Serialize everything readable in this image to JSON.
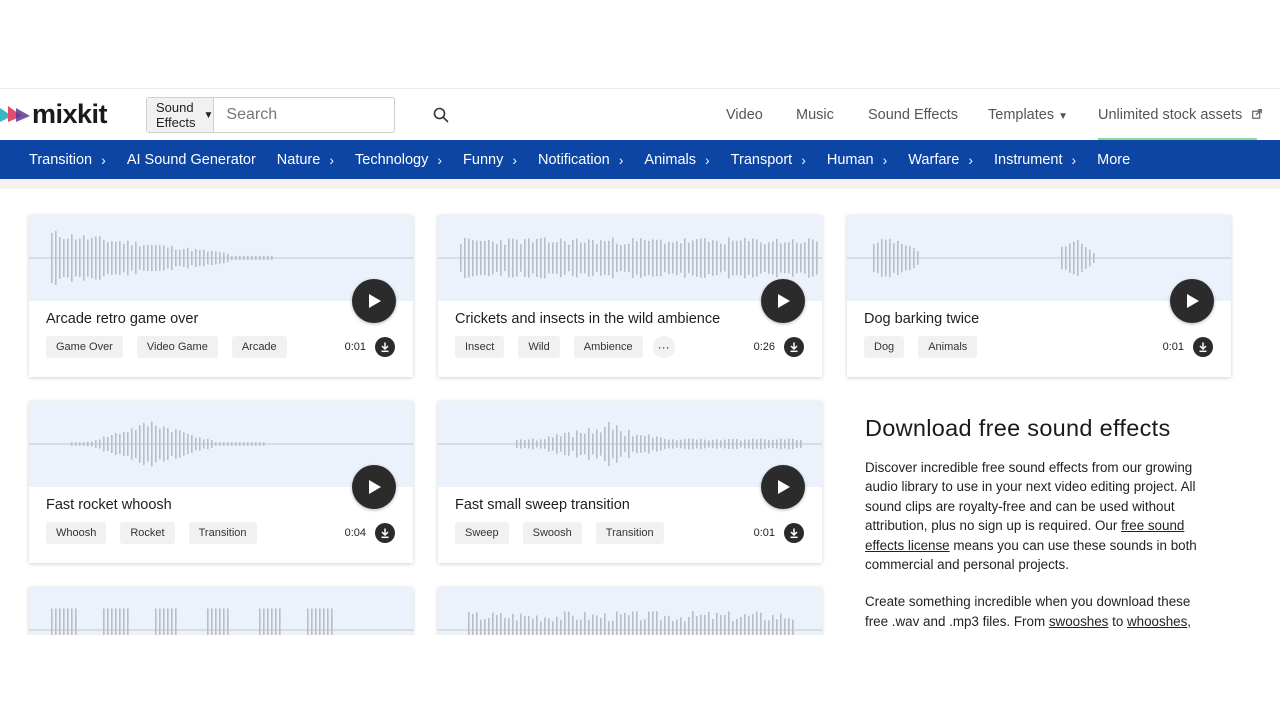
{
  "header": {
    "logo_text": "mixkit",
    "search": {
      "category": "Sound Effects",
      "placeholder": "Search"
    },
    "nav": {
      "video": "Video",
      "music": "Music",
      "sound_effects": "Sound Effects",
      "templates": "Templates",
      "unlimited": "Unlimited stock assets"
    }
  },
  "categories": [
    "Transition",
    "AI Sound Generator",
    "Nature",
    "Technology",
    "Funny",
    "Notification",
    "Animals",
    "Transport",
    "Human",
    "Warfare",
    "Instrument",
    "More"
  ],
  "cards": [
    {
      "title": "Arcade retro game over",
      "tags": [
        "Game Over",
        "Video Game",
        "Arcade"
      ],
      "duration": "0:01"
    },
    {
      "title": "Crickets and insects in the wild ambience",
      "tags": [
        "Insect",
        "Wild",
        "Ambience"
      ],
      "more": "···",
      "duration": "0:26"
    },
    {
      "title": "Dog barking twice",
      "tags": [
        "Dog",
        "Animals"
      ],
      "duration": "0:01"
    },
    {
      "title": "Fast rocket whoosh",
      "tags": [
        "Whoosh",
        "Rocket",
        "Transition"
      ],
      "duration": "0:04"
    },
    {
      "title": "Fast small sweep transition",
      "tags": [
        "Sweep",
        "Swoosh",
        "Transition"
      ],
      "duration": "0:01"
    }
  ],
  "panel": {
    "heading": "Download free sound effects",
    "p1_before": "Discover incredible free sound effects from our growing audio library to use in your next video editing project. All sound clips are royalty-free and can be used without attribution, plus no sign up is required. Our ",
    "p1_link": "free sound effects license",
    "p1_after": " means you can use these sounds in both commercial and personal projects.",
    "p2_before": "Create something incredible when you download these free .wav and .mp3 files. From ",
    "p2_link1": "swooshes",
    "p2_mid": " to ",
    "p2_link2": "whooshes",
    "p2_after": ","
  },
  "colors": {
    "category_bar": "#0d45a5",
    "wave_bg": "#ecf2fc",
    "wave_bar": "#b9bdc4",
    "play_button": "#2b2b2b",
    "accent_underline": "#8fd79a"
  },
  "icons": {
    "search": "search-icon",
    "dropdown": "caret-down-icon",
    "chevron": "chevron-right-icon",
    "play": "play-icon",
    "download": "download-icon",
    "external": "external-link-icon"
  }
}
